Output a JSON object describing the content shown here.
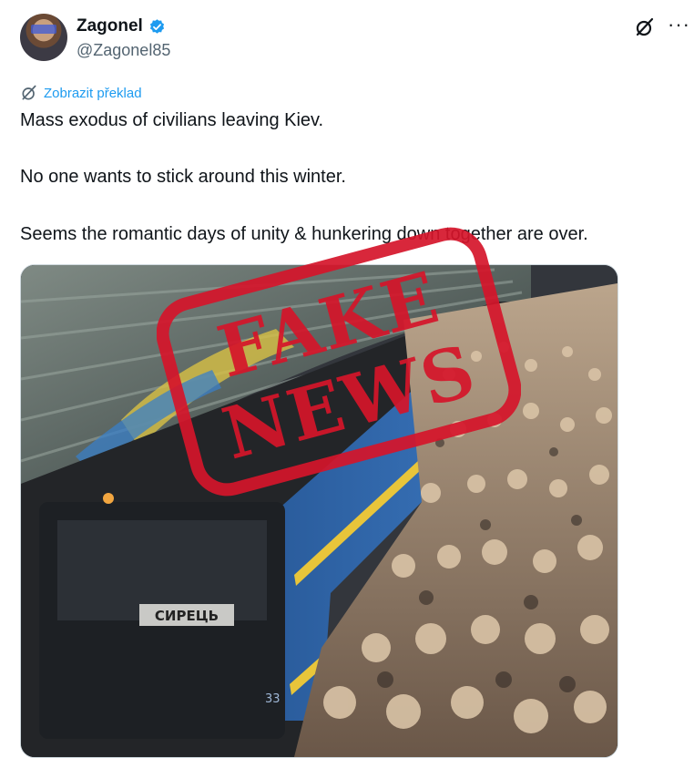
{
  "author": {
    "display_name": "Zagonel",
    "handle": "@Zagonel85",
    "verified": true
  },
  "actions": {
    "grok_icon": "grok-icon",
    "more_label": "···"
  },
  "translate": {
    "label": "Zobrazit překlad"
  },
  "tweet": {
    "line1": "Mass exodus of civilians leaving Kiev.",
    "line2": "No one wants to stick around this winter.",
    "line3": "Seems the romantic days of unity & hunkering down together are over."
  },
  "stamp": {
    "line1": "FAKE",
    "line2": "NEWS"
  },
  "media": {
    "train_plate": "СИРЕЦЬ",
    "car_number": "33"
  },
  "colors": {
    "accent": "#1d9bf0",
    "stamp": "#d5152a",
    "train": "#2f6bb6",
    "stripe": "#e8c53a"
  }
}
